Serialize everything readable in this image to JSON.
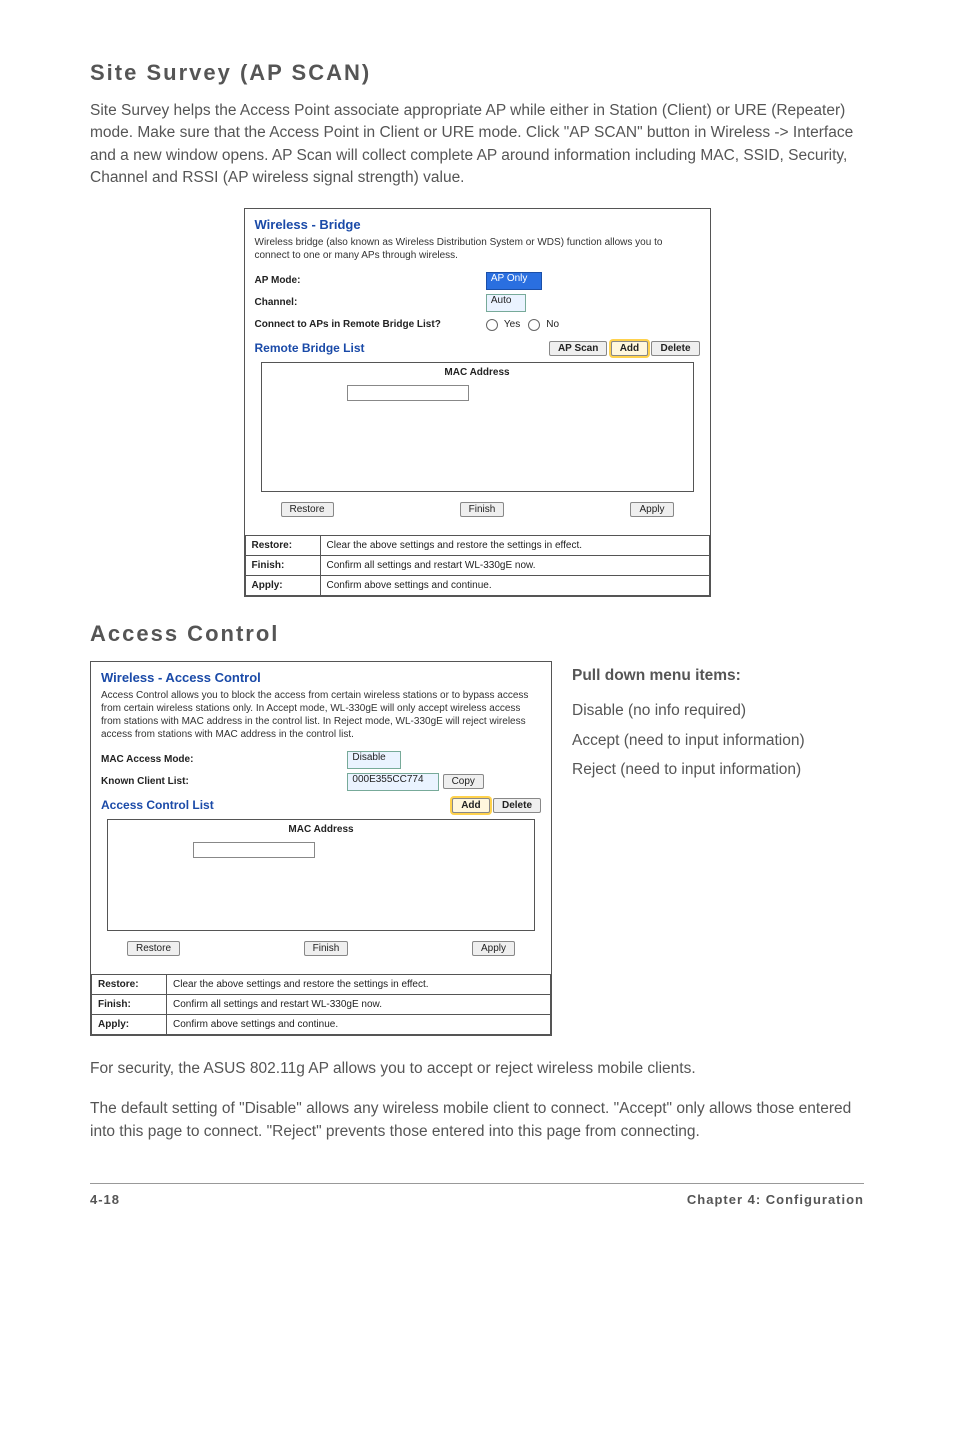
{
  "section1": {
    "title": "Site Survey (AP SCAN)",
    "para": "Site Survey helps the Access Point associate appropriate AP while either in Station (Client) or URE (Repeater) mode. Make sure that the Access Point in Client or URE mode. Click \"AP SCAN\" button in Wireless -> Interface and a new window opens. AP Scan will collect complete AP around information including MAC, SSID, Security, Channel and RSSI (AP wireless signal strength) value."
  },
  "bridge_panel": {
    "title": "Wireless - Bridge",
    "desc": "Wireless bridge (also known as Wireless Distribution System or WDS) function allows you to connect to one or many APs through wireless.",
    "rows": {
      "ap_mode_label": "AP Mode:",
      "ap_mode_value": "AP Only",
      "channel_label": "Channel:",
      "channel_value": "Auto",
      "connect_label": "Connect to APs in Remote Bridge List?",
      "yes": "Yes",
      "no": "No"
    },
    "remote_title": "Remote Bridge List",
    "btns": {
      "apscan": "AP Scan",
      "add": "Add",
      "delete": "Delete"
    },
    "mac_header": "MAC Address",
    "bottom_btns": {
      "restore": "Restore",
      "finish": "Finish",
      "apply": "Apply"
    },
    "foot": {
      "restore_k": "Restore:",
      "restore_v": "Clear the above settings and restore the settings in effect.",
      "finish_k": "Finish:",
      "finish_v": "Confirm all settings and restart WL-330gE now.",
      "apply_k": "Apply:",
      "apply_v": "Confirm above settings and continue."
    }
  },
  "section2": {
    "title": "Access Control"
  },
  "access_panel": {
    "title": "Wireless - Access Control",
    "desc": "Access Control allows you to block the access from certain wireless stations or to bypass access from certain wireless stations only. In Accept mode, WL-330gE will only accept wireless access from stations with MAC address in the control list. In Reject mode, WL-330gE will reject wireless access from stations with MAC address in the control list.",
    "rows": {
      "mode_label": "MAC Access Mode:",
      "mode_value": "Disable",
      "known_label": "Known Client List:",
      "known_value": "000E355CC774",
      "copy": "Copy"
    },
    "list_title": "Access Control List",
    "btns": {
      "add": "Add",
      "delete": "Delete"
    },
    "mac_header": "MAC Address",
    "bottom_btns": {
      "restore": "Restore",
      "finish": "Finish",
      "apply": "Apply"
    },
    "foot": {
      "restore_k": "Restore:",
      "restore_v": "Clear the above settings and restore the settings in effect.",
      "finish_k": "Finish:",
      "finish_v": "Confirm all settings and restart WL-330gE now.",
      "apply_k": "Apply:",
      "apply_v": "Confirm above settings and continue."
    }
  },
  "side": {
    "title": "Pull down menu items:",
    "l1": "Disable (no info required)",
    "l2": "Accept (need to input information)",
    "l3": "Reject (need to input information)"
  },
  "tail": {
    "p1": "For security, the ASUS 802.11g AP allows you to accept or reject wireless mobile clients.",
    "p2": "The default setting of \"Disable\" allows any wireless mobile client to connect. \"Accept\" only allows those entered into this page to connect. \"Reject\" prevents those entered into this page from connecting."
  },
  "footer": {
    "page": "4-18",
    "chapter": "Chapter 4: Configuration"
  }
}
